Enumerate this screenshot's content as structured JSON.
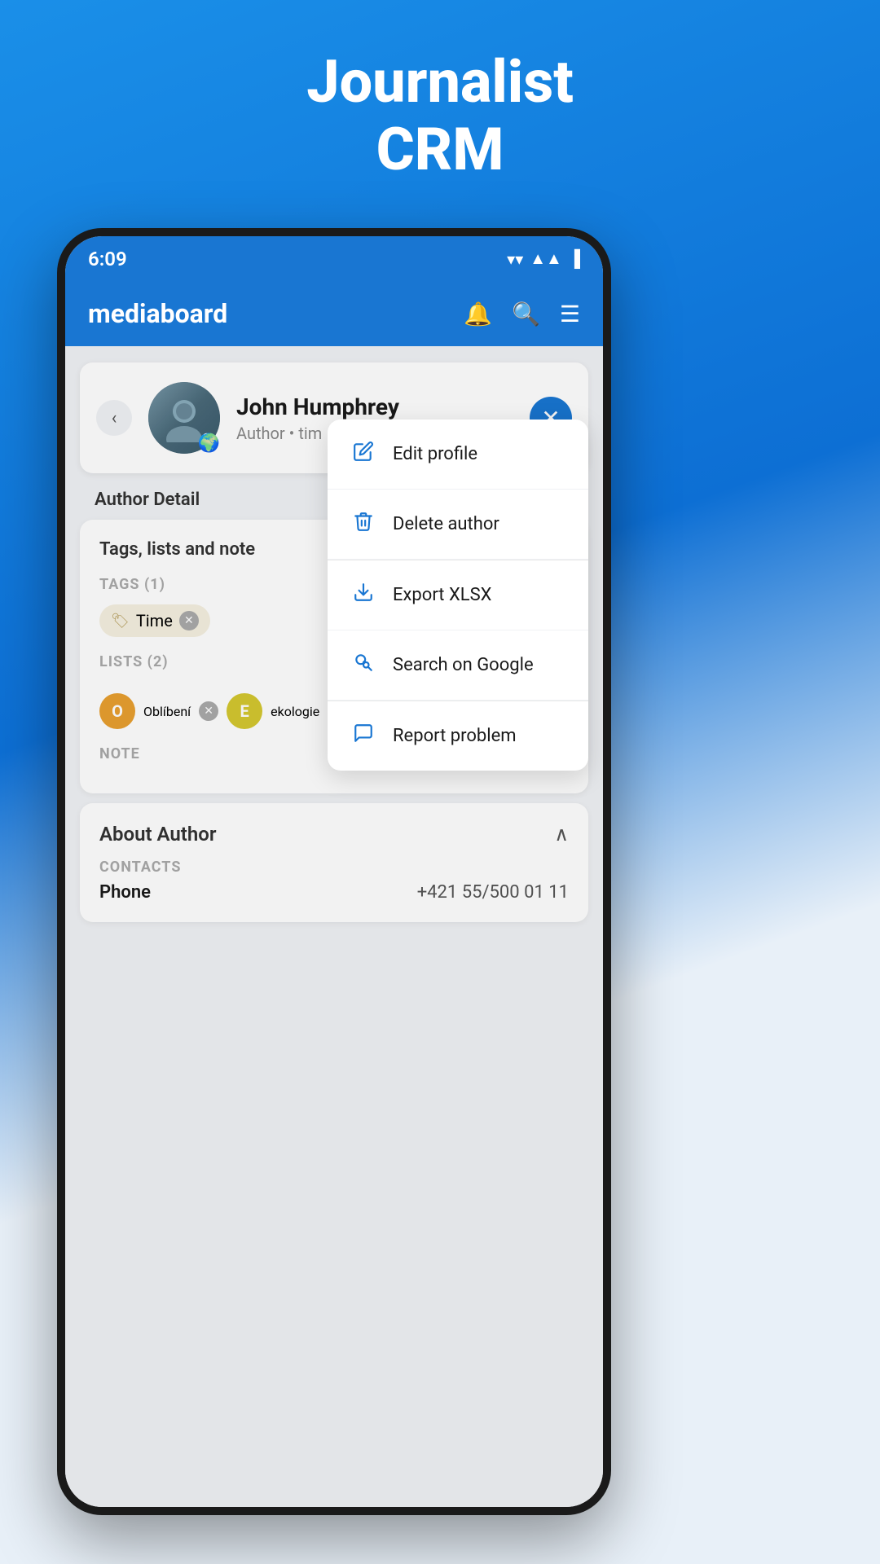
{
  "app": {
    "title_line1": "Journalist",
    "title_line2": "CRM"
  },
  "status_bar": {
    "time": "6:09",
    "wifi_icon": "▼",
    "signal_icon": "▲",
    "battery_icon": "🔋"
  },
  "nav": {
    "brand": "mediaboard",
    "bell_icon": "🔔",
    "search_icon": "🔍",
    "menu_icon": "☰"
  },
  "profile": {
    "name": "John Humphrey",
    "role": "Author • tim",
    "avatar_emoji": "👤",
    "globe_emoji": "🌍"
  },
  "dropdown": {
    "items": [
      {
        "icon": "✏️",
        "label": "Edit profile"
      },
      {
        "icon": "🗑️",
        "label": "Delete author"
      },
      {
        "icon": "⬇️",
        "label": "Export XLSX"
      },
      {
        "icon": "🔍",
        "label": "Search on Google"
      },
      {
        "icon": "💬",
        "label": "Report problem"
      }
    ]
  },
  "author_detail": {
    "section_title": "Author Detail",
    "tags_card": {
      "title": "Tags, lists and note",
      "tags_label": "TAGS (1)",
      "tags": [
        {
          "name": "Time"
        }
      ],
      "lists_label": "LISTS (2)",
      "lists": [
        {
          "initial": "O",
          "name": "Oblíbení",
          "color": "#e8a030"
        },
        {
          "initial": "E",
          "name": "ekologie",
          "color": "#d4c830"
        }
      ],
      "note_label": "NOTE"
    },
    "about_card": {
      "title": "About Author",
      "contacts_label": "CONTACTS",
      "phone_label": "Phone",
      "phone_value": "+421 55/500 01 11"
    }
  }
}
